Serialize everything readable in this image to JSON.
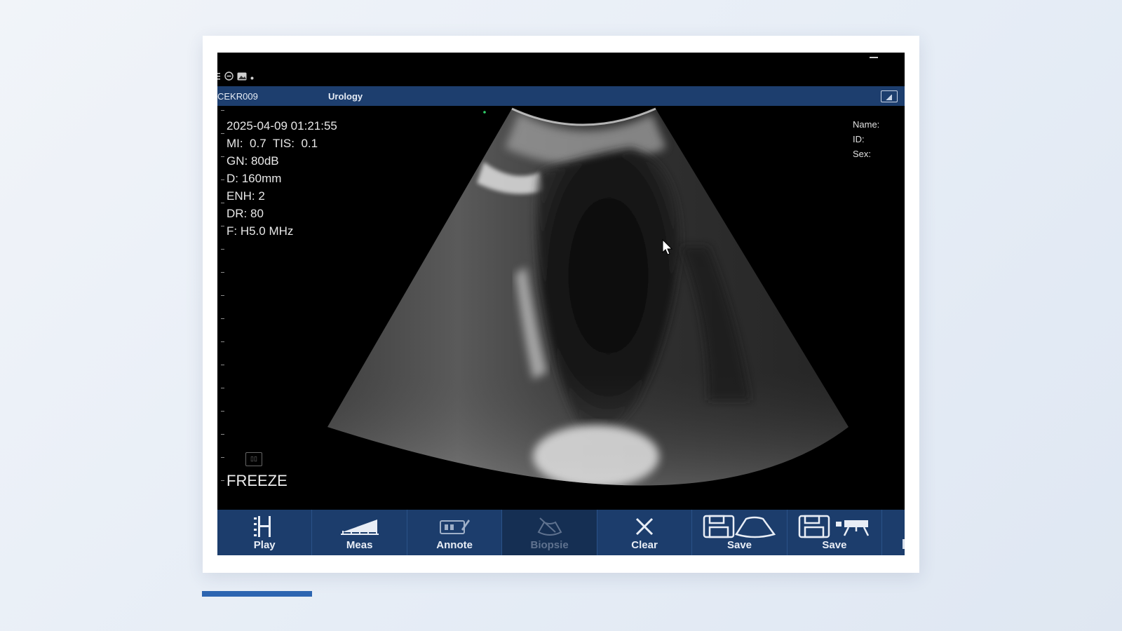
{
  "status": {
    "icons": [
      "menu-icon",
      "circle-minus-icon",
      "image-icon",
      "dot-icon"
    ]
  },
  "header": {
    "probe": "CEKR009",
    "preset": "Urology"
  },
  "params": {
    "datetime": "2025-04-09 01:21:55",
    "mi_tis": "MI:  0.7  TIS:  0.1",
    "gain": "GN: 80dB",
    "depth": "D: 160mm",
    "enh": "ENH: 2",
    "dr": "DR: 80",
    "freq": "F: H5.0 MHz"
  },
  "patient": {
    "name": "Name:",
    "id": "ID:",
    "sex": "Sex:"
  },
  "freeze": {
    "label": "FREEZE"
  },
  "toolbar": {
    "play": "Play",
    "meas": "Meas",
    "annote": "Annote",
    "biopsie": "Biopsie",
    "clear": "Clear",
    "save_image": "Save",
    "save_video": "Save"
  },
  "colors": {
    "header": "#1d3e6e",
    "toolbar": "#1c3d6c",
    "accent": "#2d65b1"
  }
}
